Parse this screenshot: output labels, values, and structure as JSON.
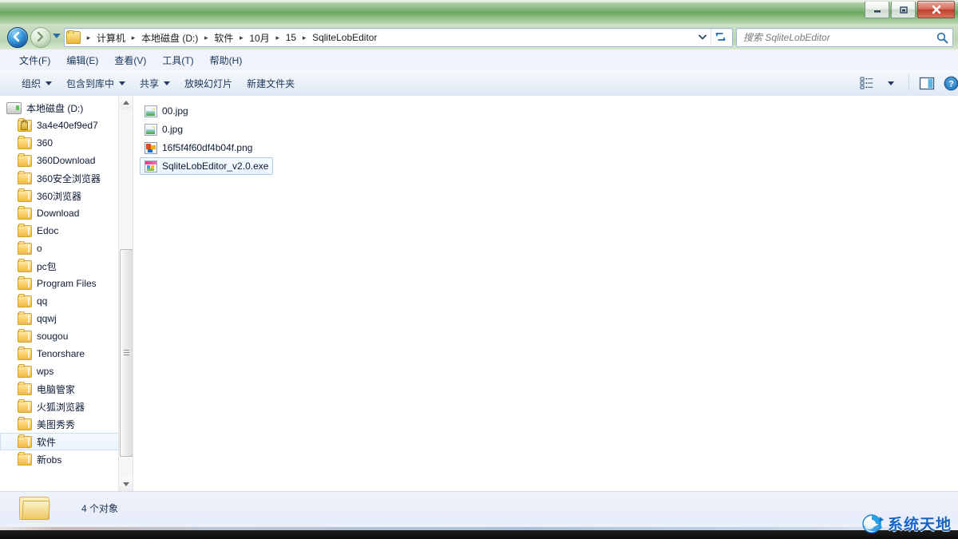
{
  "window": {
    "minimize_label": "最小化",
    "maximize_label": "最大化",
    "close_label": "关闭"
  },
  "navigation": {
    "back_label": "后退",
    "forward_label": "前进",
    "recent_label": "最近浏览的位置",
    "dropdown_label": "以前的位置",
    "refresh_label": "刷新"
  },
  "address": {
    "crumbs": [
      {
        "label": "计算机"
      },
      {
        "label": "本地磁盘 (D:)"
      },
      {
        "label": "软件"
      },
      {
        "label": "10月"
      },
      {
        "label": "15"
      },
      {
        "label": "SqliteLobEditor"
      }
    ],
    "separator": "▸"
  },
  "search": {
    "placeholder": "搜索 SqliteLobEditor",
    "value": ""
  },
  "menubar": {
    "items": [
      {
        "label": "文件(F)"
      },
      {
        "label": "编辑(E)"
      },
      {
        "label": "查看(V)"
      },
      {
        "label": "工具(T)"
      },
      {
        "label": "帮助(H)"
      }
    ]
  },
  "toolbar": {
    "buttons": [
      {
        "label": "组织",
        "has_caret": true
      },
      {
        "label": "包含到库中",
        "has_caret": true
      },
      {
        "label": "共享",
        "has_caret": true
      },
      {
        "label": "放映幻灯片",
        "has_caret": false
      },
      {
        "label": "新建文件夹",
        "has_caret": false
      }
    ],
    "view_button_label": "更改您的视图",
    "view_caret_label": "视图选项",
    "preview_button_label": "显示预览窗格",
    "help_button_label": "获取帮助"
  },
  "sidebar": {
    "items": [
      {
        "label": "本地磁盘 (D:)",
        "icon": "drive-icon",
        "root": true,
        "selected": false,
        "locked": false
      },
      {
        "label": "3a4e40ef9ed7",
        "icon": "folder-locked-icon",
        "root": false,
        "selected": false,
        "locked": true
      },
      {
        "label": "360",
        "icon": "folder-icon",
        "root": false,
        "selected": false,
        "locked": false
      },
      {
        "label": "360Download",
        "icon": "folder-icon",
        "root": false,
        "selected": false,
        "locked": false
      },
      {
        "label": "360安全浏览器",
        "icon": "folder-icon",
        "root": false,
        "selected": false,
        "locked": false
      },
      {
        "label": "360浏览器",
        "icon": "folder-icon",
        "root": false,
        "selected": false,
        "locked": false
      },
      {
        "label": "Download",
        "icon": "folder-icon",
        "root": false,
        "selected": false,
        "locked": false
      },
      {
        "label": "Edoc",
        "icon": "folder-icon",
        "root": false,
        "selected": false,
        "locked": false
      },
      {
        "label": "o",
        "icon": "folder-icon",
        "root": false,
        "selected": false,
        "locked": false
      },
      {
        "label": "pc包",
        "icon": "folder-icon",
        "root": false,
        "selected": false,
        "locked": false
      },
      {
        "label": "Program Files",
        "icon": "folder-icon",
        "root": false,
        "selected": false,
        "locked": false
      },
      {
        "label": "qq",
        "icon": "folder-icon",
        "root": false,
        "selected": false,
        "locked": false
      },
      {
        "label": "qqwj",
        "icon": "folder-icon",
        "root": false,
        "selected": false,
        "locked": false
      },
      {
        "label": "sougou",
        "icon": "folder-icon",
        "root": false,
        "selected": false,
        "locked": false
      },
      {
        "label": "Tenorshare",
        "icon": "folder-icon",
        "root": false,
        "selected": false,
        "locked": false
      },
      {
        "label": "wps",
        "icon": "folder-icon",
        "root": false,
        "selected": false,
        "locked": false
      },
      {
        "label": "电脑管家",
        "icon": "folder-icon",
        "root": false,
        "selected": false,
        "locked": false
      },
      {
        "label": "火狐浏览器",
        "icon": "folder-icon",
        "root": false,
        "selected": false,
        "locked": false
      },
      {
        "label": "美图秀秀",
        "icon": "folder-icon",
        "root": false,
        "selected": false,
        "locked": false
      },
      {
        "label": "软件",
        "icon": "folder-icon",
        "root": false,
        "selected": true,
        "locked": false
      },
      {
        "label": "新obs",
        "icon": "folder-icon",
        "root": false,
        "selected": false,
        "locked": false
      }
    ]
  },
  "files": {
    "items": [
      {
        "name": "00.jpg",
        "icon": "image-file-icon",
        "selected": false
      },
      {
        "name": "0.jpg",
        "icon": "image-file-icon",
        "selected": false
      },
      {
        "name": "16f5f4f60df4b04f.png",
        "icon": "png-file-icon",
        "selected": false
      },
      {
        "name": "SqliteLobEditor_v2.0.exe",
        "icon": "exe-file-icon",
        "selected": true
      }
    ]
  },
  "statusbar": {
    "count_text": "4 个对象"
  },
  "watermark": {
    "text": "系统天地"
  },
  "colors": {
    "titlebar_green": "#7db073",
    "accent_blue": "#1464c8",
    "selection_blue": "#a9cdea",
    "close_red": "#bc3f2b"
  }
}
